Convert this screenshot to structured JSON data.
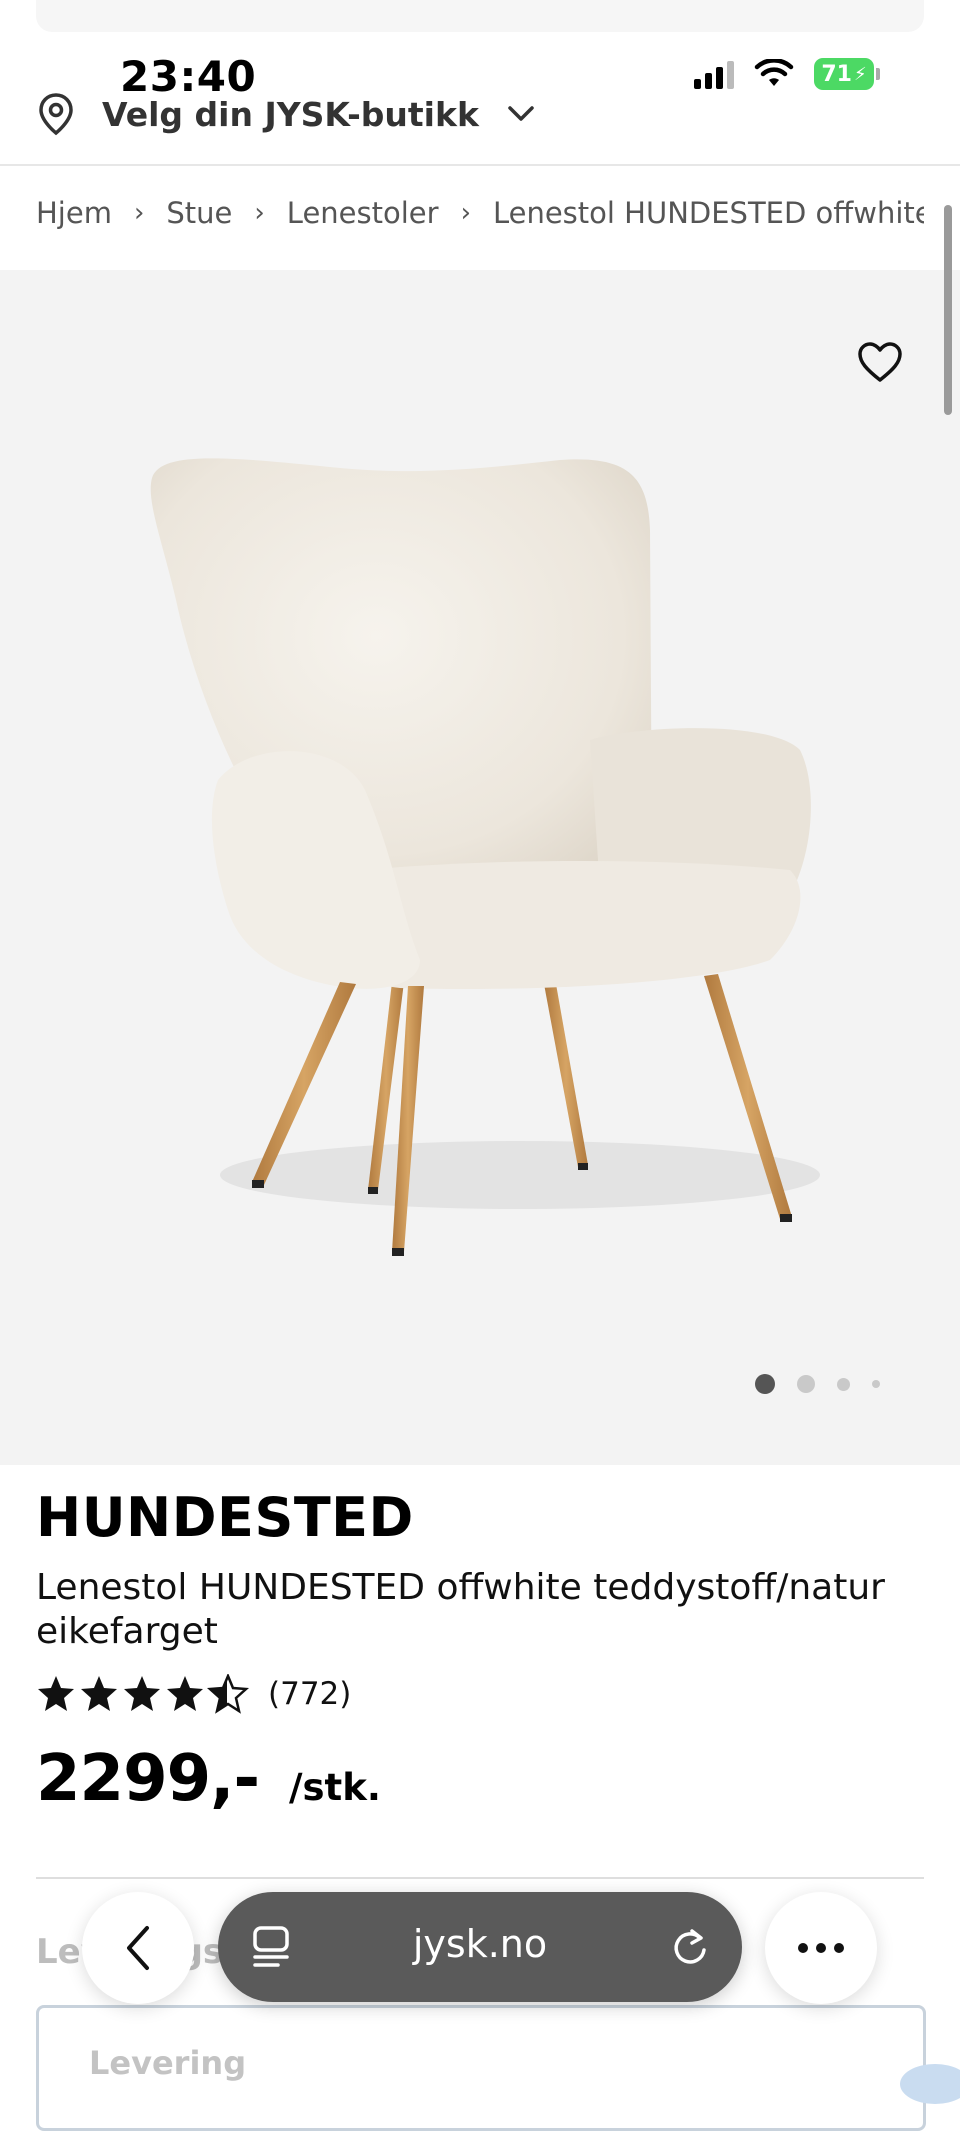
{
  "status_bar": {
    "time": "23:40",
    "battery": "71"
  },
  "header": {
    "store_label": "Velg din JYSK-butikk"
  },
  "breadcrumb": [
    "Hjem",
    "Stue",
    "Lenestoler",
    "Lenestol HUNDESTED offwhite teddystoff/natur eikefarget"
  ],
  "product": {
    "name": "HUNDESTED",
    "description": "Lenestol HUNDESTED offwhite teddystoff/natur eikefarget",
    "rating": 4.5,
    "review_count": "(772)",
    "price": "2299,-",
    "unit": "/stk."
  },
  "gallery": {
    "image_count": 4,
    "active_index": 0
  },
  "delivery": {
    "heading": "Leveringsvalg",
    "box_label": "Levering"
  },
  "browser": {
    "url": "jysk.no"
  },
  "colors": {
    "gallery_bg": "#f3f3f3",
    "battery": "#4cd964",
    "urlbar": "#5a5a5a"
  }
}
